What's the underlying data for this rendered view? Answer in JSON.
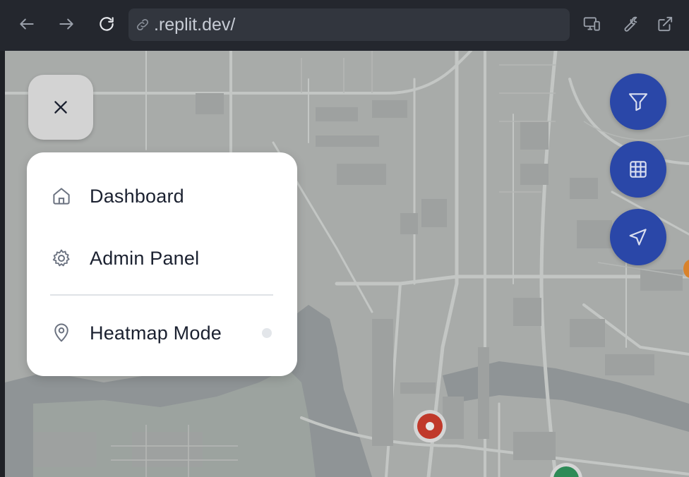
{
  "browser": {
    "url": ".replit.dev/",
    "icons": {
      "back": "arrow-left-icon",
      "forward": "arrow-right-icon",
      "reload": "reload-icon",
      "link": "link-icon",
      "devices": "devices-icon",
      "tools": "wrench-icon",
      "open_external": "external-link-icon"
    }
  },
  "menu": {
    "items": [
      {
        "label": "Dashboard",
        "icon": "home-icon"
      },
      {
        "label": "Admin Panel",
        "icon": "gear-icon"
      },
      {
        "label": "Heatmap Mode",
        "icon": "map-pin-icon"
      }
    ]
  },
  "fabs": [
    {
      "icon": "filter-icon"
    },
    {
      "icon": "grid-icon"
    },
    {
      "icon": "navigation-icon"
    }
  ],
  "colors": {
    "toolbar_bg": "#24272e",
    "fab_blue": "#2a47a8",
    "marker_red": "#c0392b",
    "marker_green": "#2e8b57",
    "marker_orange": "#d9822b"
  }
}
